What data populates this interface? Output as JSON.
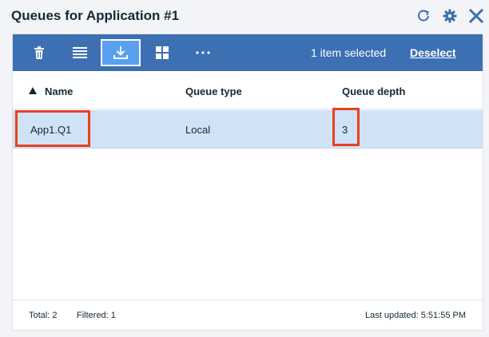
{
  "window": {
    "title": "Queues for Application #1"
  },
  "header_icons": [
    "refresh-icon",
    "gear-icon",
    "close-icon"
  ],
  "toolbar": {
    "buttons": [
      "trash-icon",
      "list-view-icon",
      "download-icon",
      "grid-view-icon",
      "more-icon"
    ],
    "active_button": "download-icon",
    "selection_text": "1 item selected",
    "deselect_label": "Deselect"
  },
  "table": {
    "columns": [
      "Name",
      "Queue type",
      "Queue depth"
    ],
    "sort_column": "Name",
    "rows": [
      {
        "name": "App1.Q1",
        "queue_type": "Local",
        "queue_depth": "3",
        "selected": true
      }
    ]
  },
  "footer": {
    "total": "Total: 2",
    "filtered": "Filtered: 1",
    "last_updated": "Last updated: 5:51:55 PM"
  },
  "colors": {
    "toolbar": "#3d70b2",
    "selected_row": "#d0e2f5",
    "highlight": "#e8411f",
    "accent": "#3d70b2"
  }
}
